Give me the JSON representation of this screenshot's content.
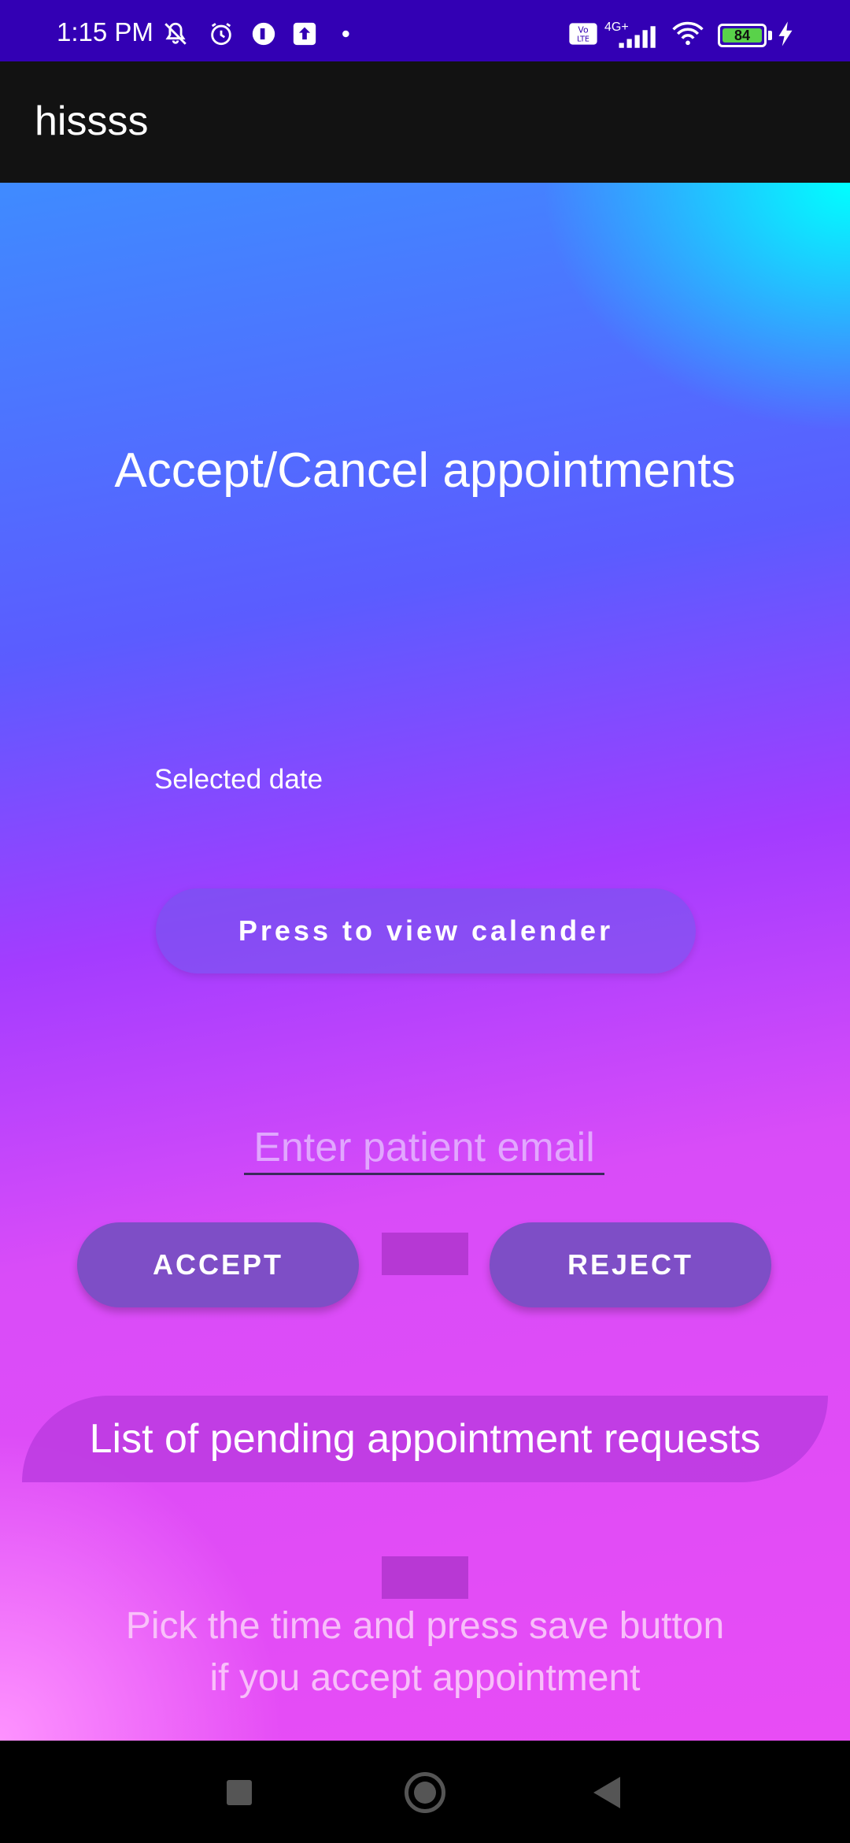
{
  "status_bar": {
    "time": "1:15 PM",
    "battery": "84",
    "battery_level": 0.84,
    "network": "4G+",
    "icons": [
      "mute-icon",
      "alarm-icon",
      "app-icon",
      "upload-icon",
      "dot-icon",
      "volte-icon",
      "signal-icon",
      "wifi-icon",
      "battery-icon",
      "charging-icon"
    ]
  },
  "app_bar": {
    "title": "hissss"
  },
  "main": {
    "headline": "Accept/Cancel appointments",
    "selected_date_label": "Selected date",
    "calendar_button": "Press to view calender",
    "email_placeholder": "Enter patient email",
    "accept_button": "ACCEPT",
    "reject_button": "REJECT",
    "pending_banner": "List of pending appointment requests",
    "hint_line1": "Pick the time and press save button",
    "hint_line2": "if you accept appointment"
  },
  "nav_bar": {
    "buttons": [
      "recents-icon",
      "home-icon",
      "back-icon"
    ]
  }
}
